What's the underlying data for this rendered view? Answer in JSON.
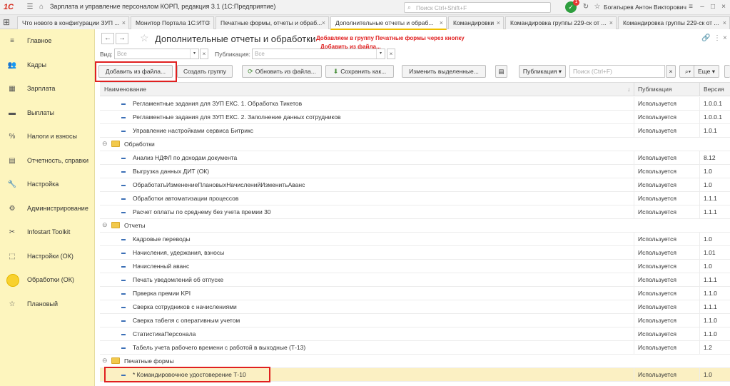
{
  "titlebar": {
    "logo": "1С",
    "app_title": "Зарплата и управление персоналом КОРП, редакция 3.1  (1С:Предприятие)",
    "search_placeholder": "Поиск Ctrl+Shift+F",
    "notification_count": "1",
    "user": "Богатырев Антон Викторович"
  },
  "tabs": [
    {
      "label": "Что нового в конфигурации ЗУП ..."
    },
    {
      "label": "Монитор Портала 1С:ИТС"
    },
    {
      "label": "Печатные формы, отчеты и обраб..."
    },
    {
      "label": "Дополнительные отчеты и обраб..."
    },
    {
      "label": "Командировки"
    },
    {
      "label": "Командировка группы 229-ск от ..."
    },
    {
      "label": "Командировка группы 229-ск от ..."
    }
  ],
  "sidebar": {
    "items": [
      {
        "label": "Главное",
        "icon": "menu-icon"
      },
      {
        "label": "Кадры",
        "icon": "people-icon"
      },
      {
        "label": "Зарплата",
        "icon": "calculator-icon"
      },
      {
        "label": "Выплаты",
        "icon": "wallet-icon"
      },
      {
        "label": "Налоги и взносы",
        "icon": "percent-icon"
      },
      {
        "label": "Отчетность, справки",
        "icon": "report-icon"
      },
      {
        "label": "Настройка",
        "icon": "wrench-icon"
      },
      {
        "label": "Администрирование",
        "icon": "gear-icon"
      },
      {
        "label": "Infostart Toolkit",
        "icon": "tools-icon"
      },
      {
        "label": "Настройки (ОК)",
        "icon": "settings-ok-icon"
      },
      {
        "label": "Обработки (ОК)",
        "icon": "processing-ok-icon"
      },
      {
        "label": "Плановый",
        "icon": "star-icon"
      }
    ]
  },
  "main": {
    "title": "Дополнительные отчеты и обработки",
    "annotation_line1": "Добавляем в группу Печатные формы через кнопку",
    "annotation_line2": "Добавить из файла...",
    "filter_kind_label": "Вид:",
    "filter_kind_placeholder": "Все",
    "filter_pub_label": "Публикация:",
    "filter_pub_placeholder": "Все",
    "buttons": {
      "add_from_file": "Добавить из файла...",
      "create_group": "Создать группу",
      "update_from_file": "Обновить из файла...",
      "save_as": "Сохранить как...",
      "change_selected": "Изменить выделенные...",
      "publication": "Публикация",
      "search_placeholder": "Поиск (Ctrl+F)",
      "more": "Еще"
    },
    "table": {
      "columns": [
        "Наименование",
        "Публикация",
        "Версия"
      ],
      "rows": [
        {
          "type": "item",
          "name": "Регламентные задания для ЗУП ЕКС. 1. Обработка Тикетов",
          "pub": "Используется",
          "ver": "1.0.0.1"
        },
        {
          "type": "item",
          "name": "Регламентные задания для ЗУП ЕКС. 2. Заполнение данных сотрудников",
          "pub": "Используется",
          "ver": "1.0.0.1"
        },
        {
          "type": "item",
          "name": "Управление настройками сервиса Битрикс",
          "pub": "Используется",
          "ver": "1.0.1"
        },
        {
          "type": "group",
          "name": "Обработки",
          "pub": "",
          "ver": ""
        },
        {
          "type": "item",
          "name": "Анализ НДФЛ по доходам документа",
          "pub": "Используется",
          "ver": "8.12"
        },
        {
          "type": "item",
          "name": "Выгрузка данных ДИТ (ОК)",
          "pub": "Используется",
          "ver": "1.0"
        },
        {
          "type": "item",
          "name": "ОбработатьИзменениеПлановыхНачисленийИзменитьАванс",
          "pub": "Используется",
          "ver": "1.0"
        },
        {
          "type": "item",
          "name": "Обработки автоматизации процессов",
          "pub": "Используется",
          "ver": "1.1.1"
        },
        {
          "type": "item",
          "name": "Расчет оплаты по среднему без учета премии 30",
          "pub": "Используется",
          "ver": "1.1.1"
        },
        {
          "type": "group",
          "name": "Отчеты",
          "pub": "",
          "ver": ""
        },
        {
          "type": "item",
          "name": "Кадровые переводы",
          "pub": "Используется",
          "ver": "1.0"
        },
        {
          "type": "item",
          "name": "Начисления, удержания, взносы",
          "pub": "Используется",
          "ver": "1.01"
        },
        {
          "type": "item",
          "name": "Начисленный аванс",
          "pub": "Используется",
          "ver": "1.0"
        },
        {
          "type": "item",
          "name": "Печать уведомлений об отпуске",
          "pub": "Используется",
          "ver": "1.1.1"
        },
        {
          "type": "item",
          "name": "Прверка премии KPI",
          "pub": "Используется",
          "ver": "1.1.0"
        },
        {
          "type": "item",
          "name": "Сверка сотрудников с начислениями",
          "pub": "Используется",
          "ver": "1.1.1"
        },
        {
          "type": "item",
          "name": "Сверка табеля с оперативным учетом",
          "pub": "Используется",
          "ver": "1.1.0"
        },
        {
          "type": "item",
          "name": "СтатистикаПерсонала",
          "pub": "Используется",
          "ver": "1.1.0"
        },
        {
          "type": "item",
          "name": "Табель учета рабочего времени с работой в выходные (Т-13)",
          "pub": "Используется",
          "ver": "1.2"
        },
        {
          "type": "group",
          "name": "Печатные формы",
          "pub": "",
          "ver": ""
        },
        {
          "type": "item",
          "name": "* Командировочное удостоверение Т-10",
          "pub": "Используется",
          "ver": "1.0",
          "selected": true
        }
      ]
    }
  }
}
